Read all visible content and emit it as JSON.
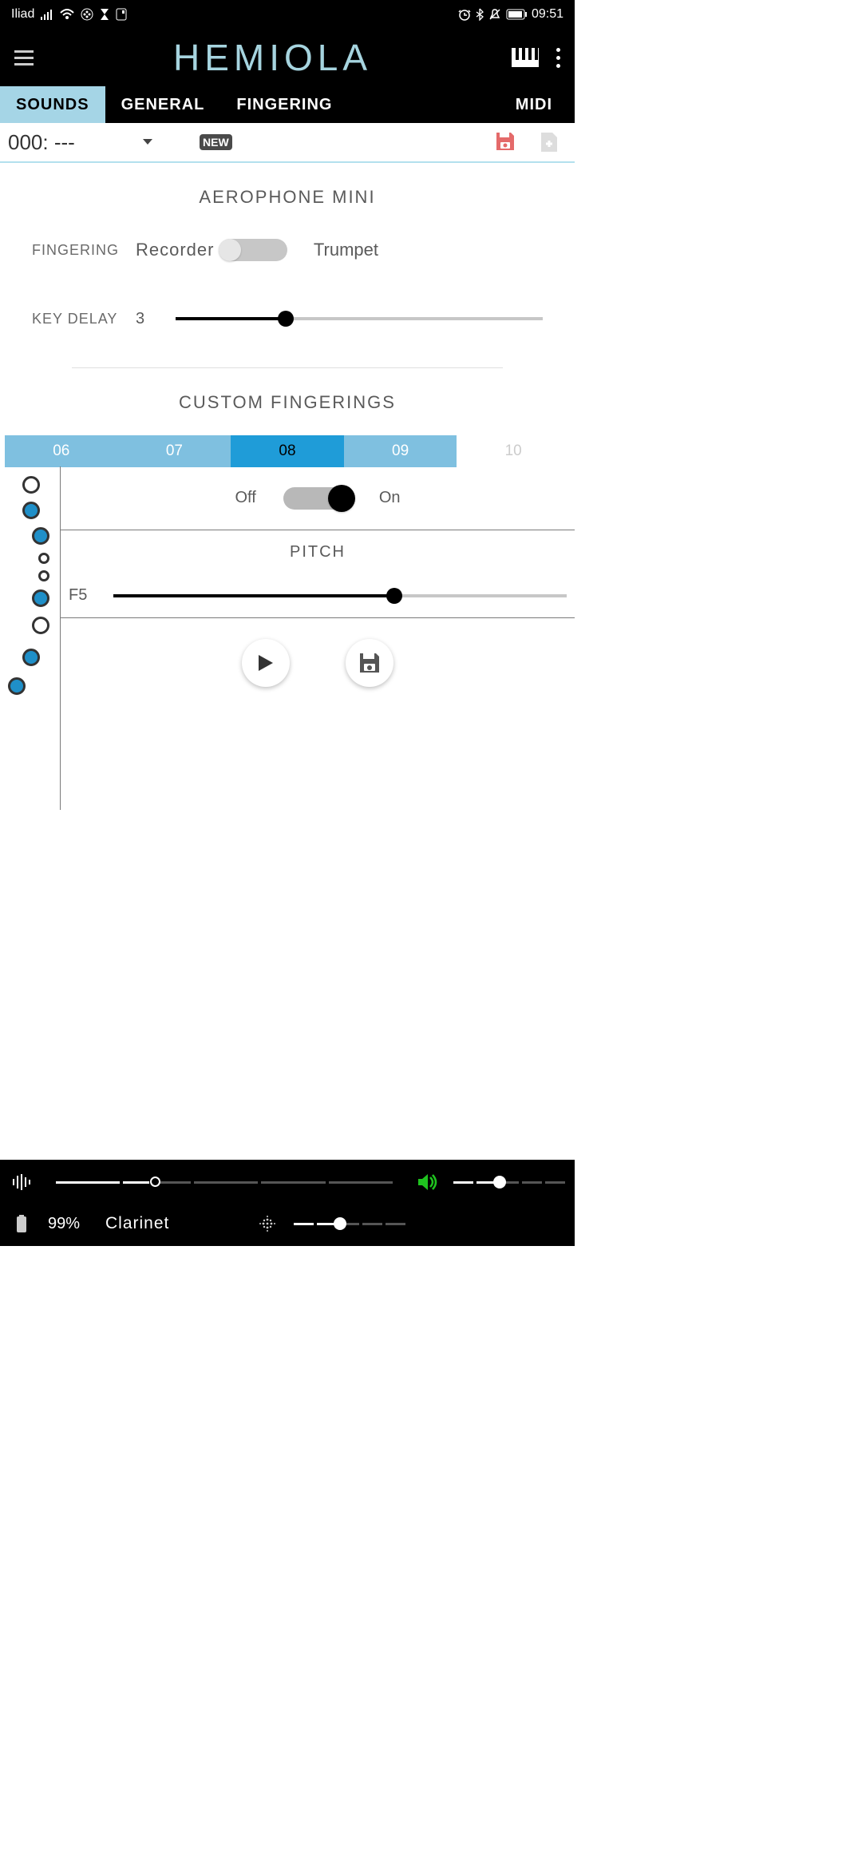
{
  "status": {
    "carrier": "Iliad",
    "time": "09:51"
  },
  "header": {
    "title": "HEMIOLA"
  },
  "tabs": [
    "SOUNDS",
    "GENERAL",
    "FINGERING",
    "MIDI"
  ],
  "active_tab": 0,
  "preset": {
    "name": "000: ---",
    "new_label": "NEW"
  },
  "aero": {
    "title": "AEROPHONE MINI",
    "fingering_label": "FINGERING",
    "fingering_left": "Recorder",
    "fingering_right": "Trumpet",
    "key_delay_label": "KEY DELAY",
    "key_delay_value": "3"
  },
  "custom": {
    "title": "CUSTOM FINGERINGS",
    "tabs": [
      "06",
      "07",
      "08",
      "09",
      "10"
    ],
    "active_tab": 2,
    "off_label": "Off",
    "on_label": "On",
    "pitch_label": "PITCH",
    "note": "F5"
  },
  "bottom": {
    "battery_pct": "99%",
    "instrument": "Clarinet"
  }
}
